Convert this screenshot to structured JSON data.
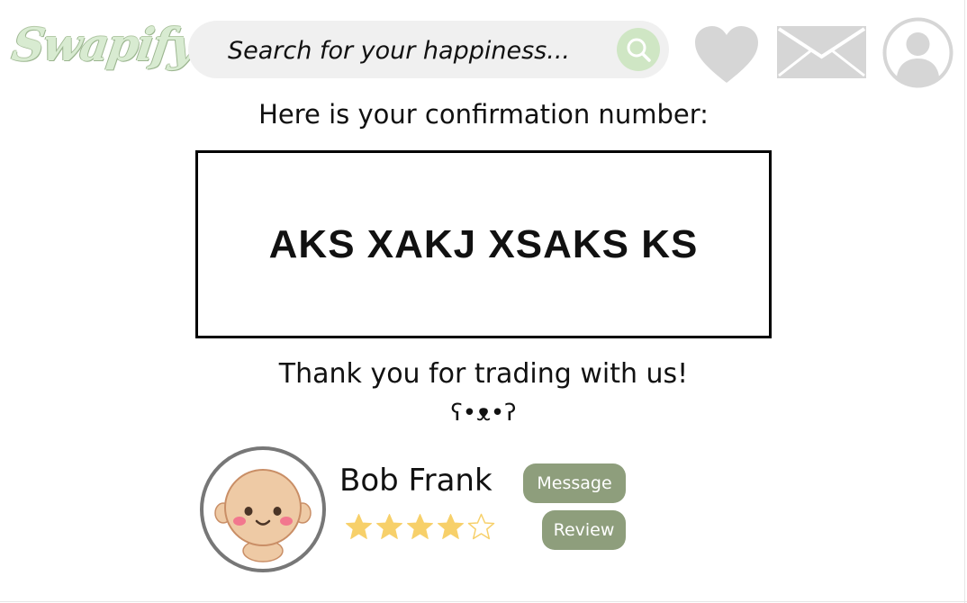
{
  "header": {
    "logo_text": "Swapify",
    "search": {
      "placeholder": "Search for your happiness..."
    },
    "icons": [
      "search-icon",
      "heart-icon",
      "mail-icon",
      "user-icon"
    ]
  },
  "confirmation": {
    "label": "Here is your confirmation number:",
    "number": "AKS XAKJ XSAKS KS",
    "thanks": "Thank you for trading with us!",
    "emoticon": "ʕ•ᴥ•ʔ"
  },
  "seller": {
    "name": "Bob Frank",
    "rating": 4,
    "rating_max": 5,
    "message_label": "Message",
    "review_label": "Review"
  },
  "colors": {
    "accent_green": "#8e9e7c",
    "search_bg": "#f0f0f0",
    "search_button": "#cfe6c4",
    "icon_gray": "#d6d6d6",
    "star_gold": "#f7d06a"
  }
}
